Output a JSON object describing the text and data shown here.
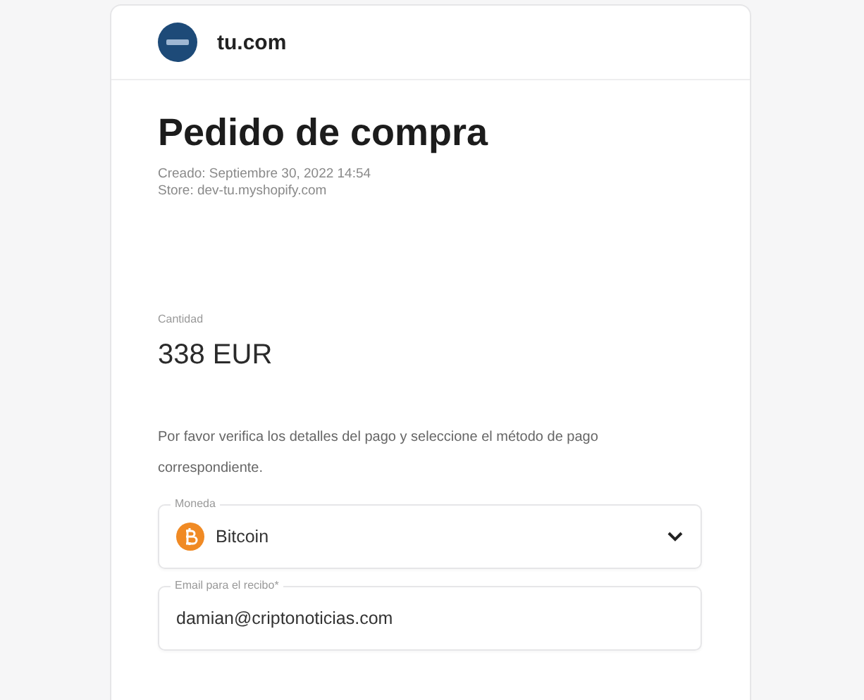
{
  "header": {
    "store_name": "tu.com"
  },
  "order": {
    "title": "Pedido de compra",
    "created": "Creado: Septiembre 30, 2022 14:54",
    "store": "Store: dev-tu.myshopify.com"
  },
  "amount": {
    "label": "Cantidad",
    "value": "338 EUR"
  },
  "instructions": "Por favor verifica los detalles del pago y seleccione el método de pago correspondiente.",
  "fields": [
    {
      "kind": "select",
      "label": "Moneda",
      "value": "Bitcoin"
    },
    {
      "kind": "input",
      "label": "Email para el recibo*",
      "value": "damian@criptonoticias.com"
    }
  ]
}
